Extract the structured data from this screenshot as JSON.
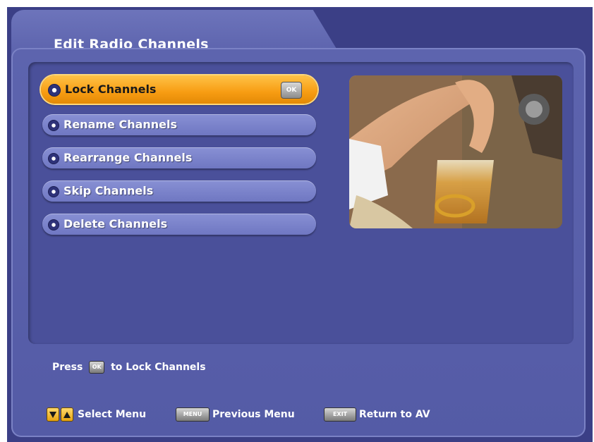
{
  "header": {
    "title": "Edit Radio Channels"
  },
  "menu": {
    "items": [
      {
        "label": "Lock Channels",
        "selected": true,
        "badge": "OK"
      },
      {
        "label": "Rename Channels"
      },
      {
        "label": "Rearrange Channels"
      },
      {
        "label": "Skip Channels"
      },
      {
        "label": "Delete Channels"
      }
    ]
  },
  "hint": {
    "press": "Press",
    "key": "OK",
    "action": "to Lock Channels"
  },
  "footer": {
    "select_label": "Select Menu",
    "menu_key": "MENU",
    "previous_label": "Previous Menu",
    "exit_key": "EXIT",
    "return_label": "Return to AV"
  },
  "colors": {
    "background": "#3b3f86",
    "panel": "#5a61ab",
    "selected": "#f79c12",
    "item": "#7a82c9"
  },
  "icons": [
    "bullet-icon",
    "ok-key-icon",
    "down-arrow-icon",
    "up-arrow-icon",
    "menu-key-icon",
    "exit-key-icon"
  ]
}
